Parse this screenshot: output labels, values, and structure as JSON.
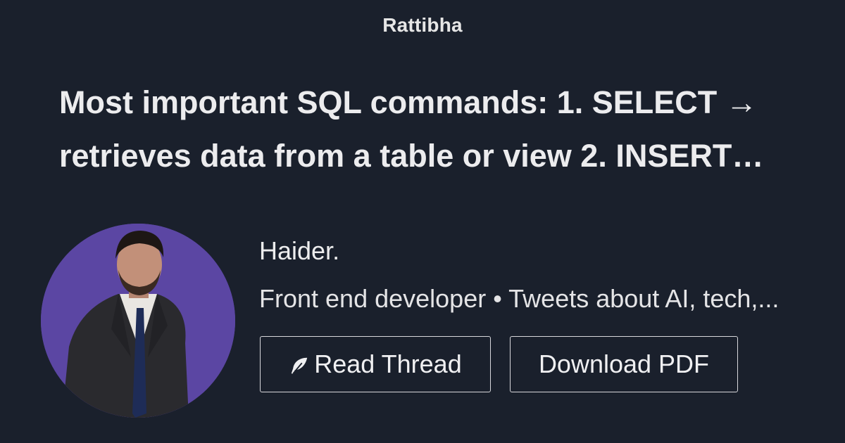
{
  "site": {
    "brand": "Rattibha"
  },
  "thread": {
    "title": "Most important SQL commands: 1. SELECT → retrieves data from a table or view 2. INSERT…"
  },
  "author": {
    "name": "Haider.",
    "bio": "Front end developer • Tweets about AI, tech,...",
    "avatar_bg": "#5b46a3"
  },
  "actions": {
    "read_label": "Read Thread",
    "read_icon": "feather-icon",
    "pdf_label": "Download PDF"
  },
  "colors": {
    "background": "#1a202c",
    "text": "#e8e8ea",
    "button_border": "#d8d8dc"
  }
}
